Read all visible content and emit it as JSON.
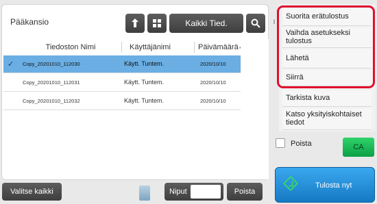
{
  "file_panel": {
    "folder_title": "Pääkansio",
    "toolbar": {
      "up_icon": "up-arrow-icon",
      "grid_icon": "grid-view-icon",
      "all_files_label": "Kaikki Tied.",
      "search_icon": "search-icon"
    },
    "columns": {
      "name": "Tiedoston Nimi",
      "user": "Käyttäjänimi",
      "date": "Päivämäärä",
      "sort_icon": "sort-descending-icon"
    },
    "rows": [
      {
        "name": "Copy_20201010_112030",
        "user": "Käytt. Tuntem.",
        "date": "2020/10/10",
        "selected": true
      },
      {
        "name": "Copy_20201010_112031",
        "user": "Käytt. Tuntem.",
        "date": "2020/10/10",
        "selected": false
      },
      {
        "name": "Copy_20201010_112032",
        "user": "Käytt. Tuntem.",
        "date": "2020/10/10",
        "selected": false
      }
    ]
  },
  "bottom_bar": {
    "select_all": "Valitse kaikki",
    "niput_label": "Niput",
    "niput_value": "",
    "delete": "Poista"
  },
  "right_panel": {
    "tab_label": "I",
    "menu_items": [
      {
        "label": "Suorita erätulostus"
      },
      {
        "label": "Vaihda asetukseksi tulostus"
      },
      {
        "label": "Lähetä"
      },
      {
        "label": "Siirrä"
      },
      {
        "label": "Tarkista kuva"
      },
      {
        "label": "Katso yksityiskohtaiset tiedot"
      }
    ],
    "delete_checkbox_label": "Poista",
    "ca_label": "CA",
    "print_now_label": "Tulosta nyt"
  },
  "colors": {
    "selected_row": "#6aaee3",
    "highlight_border": "#e0102e",
    "print_button": "#2a93de",
    "ca_button": "#1db856"
  }
}
